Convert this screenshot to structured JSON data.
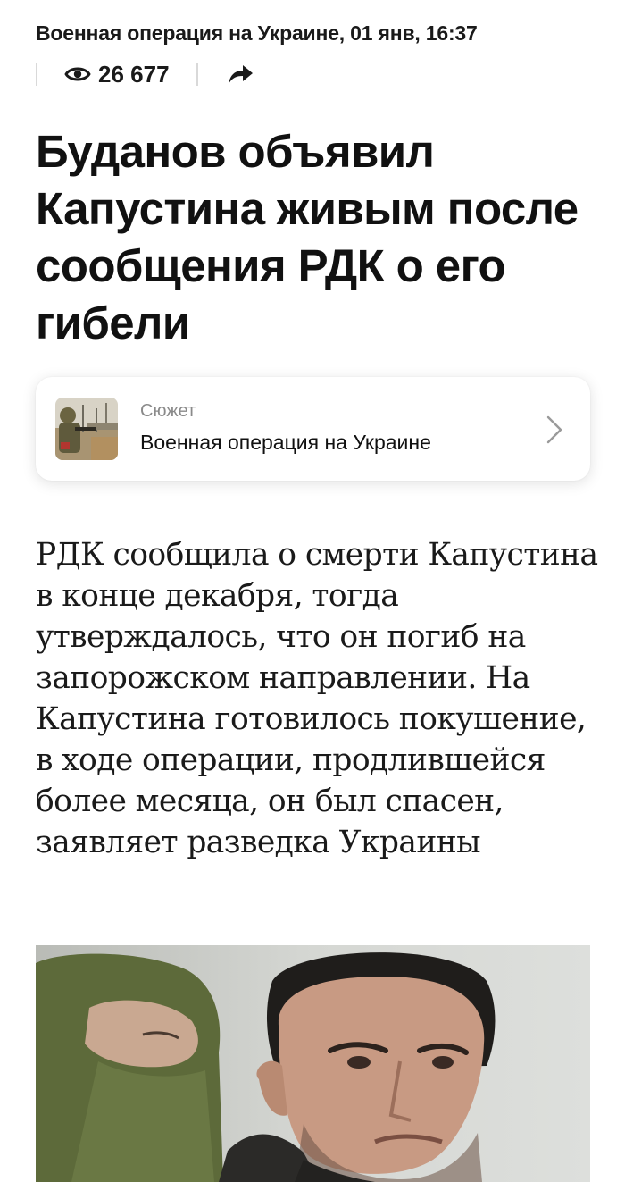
{
  "meta": {
    "category": "Военная операция на Украине",
    "date": "01 янв, 16:37"
  },
  "stats": {
    "views": "26 677",
    "eye_icon": "eye-icon",
    "share_icon": "share-arrow-icon"
  },
  "article": {
    "headline": "Буданов объявил Капустина живым после сообщения РДК о его гибели",
    "lead": "РДК сообщила о смерти Капустина в конце декабря, тогда утверждалось, что он погиб на запорожском направлении. На Капустина готовилось покушение, в ходе операции, продлившейся более месяца, он был спасен, заявляет разведка Украины"
  },
  "story_card": {
    "kicker": "Сюжет",
    "title": "Военная операция на Украине",
    "chevron_icon": "chevron-right-icon"
  },
  "colors": {
    "text": "#111111",
    "muted": "#8a8a8a",
    "divider": "#d9d9d9",
    "background": "#ffffff"
  }
}
